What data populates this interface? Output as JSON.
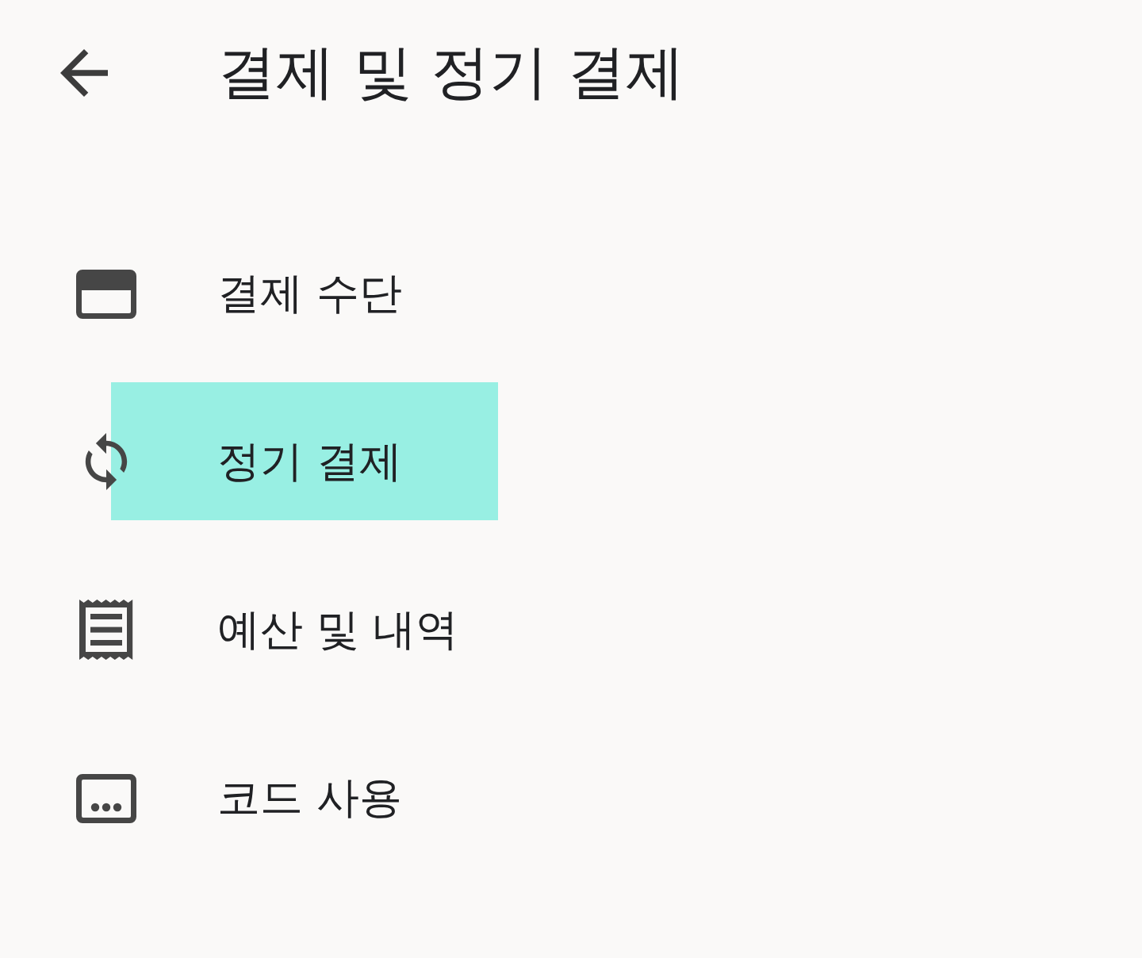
{
  "app_bar": {
    "title": "결제 및 정기 결제"
  },
  "menu": {
    "items": [
      {
        "label": "결제 수단",
        "highlighted": false
      },
      {
        "label": "정기 결제",
        "highlighted": true
      },
      {
        "label": "예산 및 내역",
        "highlighted": false
      },
      {
        "label": "코드 사용",
        "highlighted": false
      }
    ]
  }
}
